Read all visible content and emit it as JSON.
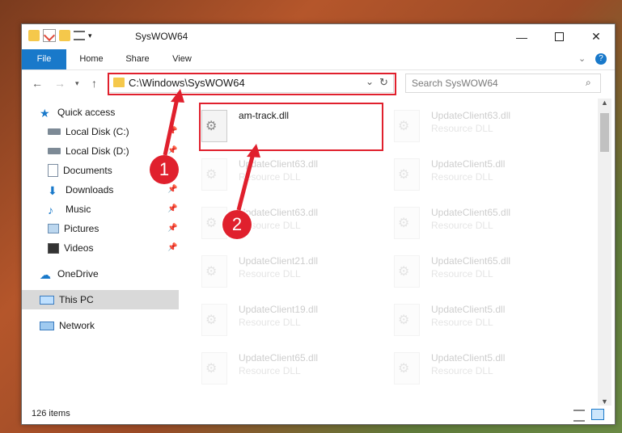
{
  "window": {
    "title": "SysWOW64"
  },
  "ribbon": {
    "tabs": [
      "File",
      "Home",
      "Share",
      "View"
    ]
  },
  "address": {
    "path": "C:\\Windows\\SysWOW64"
  },
  "search": {
    "placeholder": "Search SysWOW64"
  },
  "sidebar": {
    "items": [
      {
        "label": "Quick access",
        "icon": "star-icon",
        "pinned": false
      },
      {
        "label": "Local Disk (C:)",
        "icon": "drive-icon",
        "pinned": true
      },
      {
        "label": "Local Disk (D:)",
        "icon": "drive-icon",
        "pinned": true
      },
      {
        "label": "Documents",
        "icon": "document-icon",
        "pinned": true
      },
      {
        "label": "Downloads",
        "icon": "download-icon",
        "pinned": true
      },
      {
        "label": "Music",
        "icon": "music-icon",
        "pinned": true
      },
      {
        "label": "Pictures",
        "icon": "pictures-icon",
        "pinned": true
      },
      {
        "label": "Videos",
        "icon": "videos-icon",
        "pinned": true
      },
      {
        "label": "OneDrive",
        "icon": "cloud-icon",
        "pinned": false
      },
      {
        "label": "This PC",
        "icon": "pc-icon",
        "pinned": false
      },
      {
        "label": "Network",
        "icon": "network-icon",
        "pinned": false
      }
    ]
  },
  "files": [
    {
      "name": "am-track.dll",
      "type": ""
    },
    {
      "name": "UpdateClient63.dll",
      "type": "Resource DLL"
    },
    {
      "name": "UpdateClient63.dll",
      "type": "Resource DLL"
    },
    {
      "name": "UpdateClient5.dll",
      "type": "Resource DLL"
    },
    {
      "name": "UpdateClient63.dll",
      "type": "Resource DLL"
    },
    {
      "name": "UpdateClient65.dll",
      "type": "Resource DLL"
    },
    {
      "name": "UpdateClient21.dll",
      "type": "Resource DLL"
    },
    {
      "name": "UpdateClient65.dll",
      "type": "Resource DLL"
    },
    {
      "name": "UpdateClient19.dll",
      "type": "Resource DLL"
    },
    {
      "name": "UpdateClient5.dll",
      "type": "Resource DLL"
    },
    {
      "name": "UpdateClient65.dll",
      "type": "Resource DLL"
    },
    {
      "name": "UpdateClient5.dll",
      "type": "Resource DLL"
    }
  ],
  "status": {
    "items_count": "126 items"
  },
  "callouts": [
    "1",
    "2"
  ],
  "colors": {
    "accent": "#1979ca",
    "highlight_red": "#e0202d"
  }
}
